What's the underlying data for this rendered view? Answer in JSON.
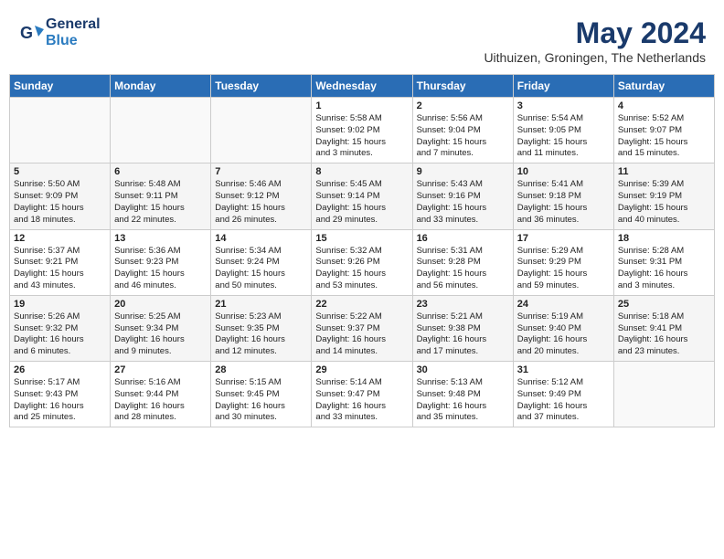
{
  "header": {
    "logo_line1": "General",
    "logo_line2": "Blue",
    "title": "May 2024",
    "subtitle": "Uithuizen, Groningen, The Netherlands"
  },
  "weekdays": [
    "Sunday",
    "Monday",
    "Tuesday",
    "Wednesday",
    "Thursday",
    "Friday",
    "Saturday"
  ],
  "weeks": [
    [
      {
        "day": "",
        "info": ""
      },
      {
        "day": "",
        "info": ""
      },
      {
        "day": "",
        "info": ""
      },
      {
        "day": "1",
        "info": "Sunrise: 5:58 AM\nSunset: 9:02 PM\nDaylight: 15 hours\nand 3 minutes."
      },
      {
        "day": "2",
        "info": "Sunrise: 5:56 AM\nSunset: 9:04 PM\nDaylight: 15 hours\nand 7 minutes."
      },
      {
        "day": "3",
        "info": "Sunrise: 5:54 AM\nSunset: 9:05 PM\nDaylight: 15 hours\nand 11 minutes."
      },
      {
        "day": "4",
        "info": "Sunrise: 5:52 AM\nSunset: 9:07 PM\nDaylight: 15 hours\nand 15 minutes."
      }
    ],
    [
      {
        "day": "5",
        "info": "Sunrise: 5:50 AM\nSunset: 9:09 PM\nDaylight: 15 hours\nand 18 minutes."
      },
      {
        "day": "6",
        "info": "Sunrise: 5:48 AM\nSunset: 9:11 PM\nDaylight: 15 hours\nand 22 minutes."
      },
      {
        "day": "7",
        "info": "Sunrise: 5:46 AM\nSunset: 9:12 PM\nDaylight: 15 hours\nand 26 minutes."
      },
      {
        "day": "8",
        "info": "Sunrise: 5:45 AM\nSunset: 9:14 PM\nDaylight: 15 hours\nand 29 minutes."
      },
      {
        "day": "9",
        "info": "Sunrise: 5:43 AM\nSunset: 9:16 PM\nDaylight: 15 hours\nand 33 minutes."
      },
      {
        "day": "10",
        "info": "Sunrise: 5:41 AM\nSunset: 9:18 PM\nDaylight: 15 hours\nand 36 minutes."
      },
      {
        "day": "11",
        "info": "Sunrise: 5:39 AM\nSunset: 9:19 PM\nDaylight: 15 hours\nand 40 minutes."
      }
    ],
    [
      {
        "day": "12",
        "info": "Sunrise: 5:37 AM\nSunset: 9:21 PM\nDaylight: 15 hours\nand 43 minutes."
      },
      {
        "day": "13",
        "info": "Sunrise: 5:36 AM\nSunset: 9:23 PM\nDaylight: 15 hours\nand 46 minutes."
      },
      {
        "day": "14",
        "info": "Sunrise: 5:34 AM\nSunset: 9:24 PM\nDaylight: 15 hours\nand 50 minutes."
      },
      {
        "day": "15",
        "info": "Sunrise: 5:32 AM\nSunset: 9:26 PM\nDaylight: 15 hours\nand 53 minutes."
      },
      {
        "day": "16",
        "info": "Sunrise: 5:31 AM\nSunset: 9:28 PM\nDaylight: 15 hours\nand 56 minutes."
      },
      {
        "day": "17",
        "info": "Sunrise: 5:29 AM\nSunset: 9:29 PM\nDaylight: 15 hours\nand 59 minutes."
      },
      {
        "day": "18",
        "info": "Sunrise: 5:28 AM\nSunset: 9:31 PM\nDaylight: 16 hours\nand 3 minutes."
      }
    ],
    [
      {
        "day": "19",
        "info": "Sunrise: 5:26 AM\nSunset: 9:32 PM\nDaylight: 16 hours\nand 6 minutes."
      },
      {
        "day": "20",
        "info": "Sunrise: 5:25 AM\nSunset: 9:34 PM\nDaylight: 16 hours\nand 9 minutes."
      },
      {
        "day": "21",
        "info": "Sunrise: 5:23 AM\nSunset: 9:35 PM\nDaylight: 16 hours\nand 12 minutes."
      },
      {
        "day": "22",
        "info": "Sunrise: 5:22 AM\nSunset: 9:37 PM\nDaylight: 16 hours\nand 14 minutes."
      },
      {
        "day": "23",
        "info": "Sunrise: 5:21 AM\nSunset: 9:38 PM\nDaylight: 16 hours\nand 17 minutes."
      },
      {
        "day": "24",
        "info": "Sunrise: 5:19 AM\nSunset: 9:40 PM\nDaylight: 16 hours\nand 20 minutes."
      },
      {
        "day": "25",
        "info": "Sunrise: 5:18 AM\nSunset: 9:41 PM\nDaylight: 16 hours\nand 23 minutes."
      }
    ],
    [
      {
        "day": "26",
        "info": "Sunrise: 5:17 AM\nSunset: 9:43 PM\nDaylight: 16 hours\nand 25 minutes."
      },
      {
        "day": "27",
        "info": "Sunrise: 5:16 AM\nSunset: 9:44 PM\nDaylight: 16 hours\nand 28 minutes."
      },
      {
        "day": "28",
        "info": "Sunrise: 5:15 AM\nSunset: 9:45 PM\nDaylight: 16 hours\nand 30 minutes."
      },
      {
        "day": "29",
        "info": "Sunrise: 5:14 AM\nSunset: 9:47 PM\nDaylight: 16 hours\nand 33 minutes."
      },
      {
        "day": "30",
        "info": "Sunrise: 5:13 AM\nSunset: 9:48 PM\nDaylight: 16 hours\nand 35 minutes."
      },
      {
        "day": "31",
        "info": "Sunrise: 5:12 AM\nSunset: 9:49 PM\nDaylight: 16 hours\nand 37 minutes."
      },
      {
        "day": "",
        "info": ""
      }
    ]
  ]
}
